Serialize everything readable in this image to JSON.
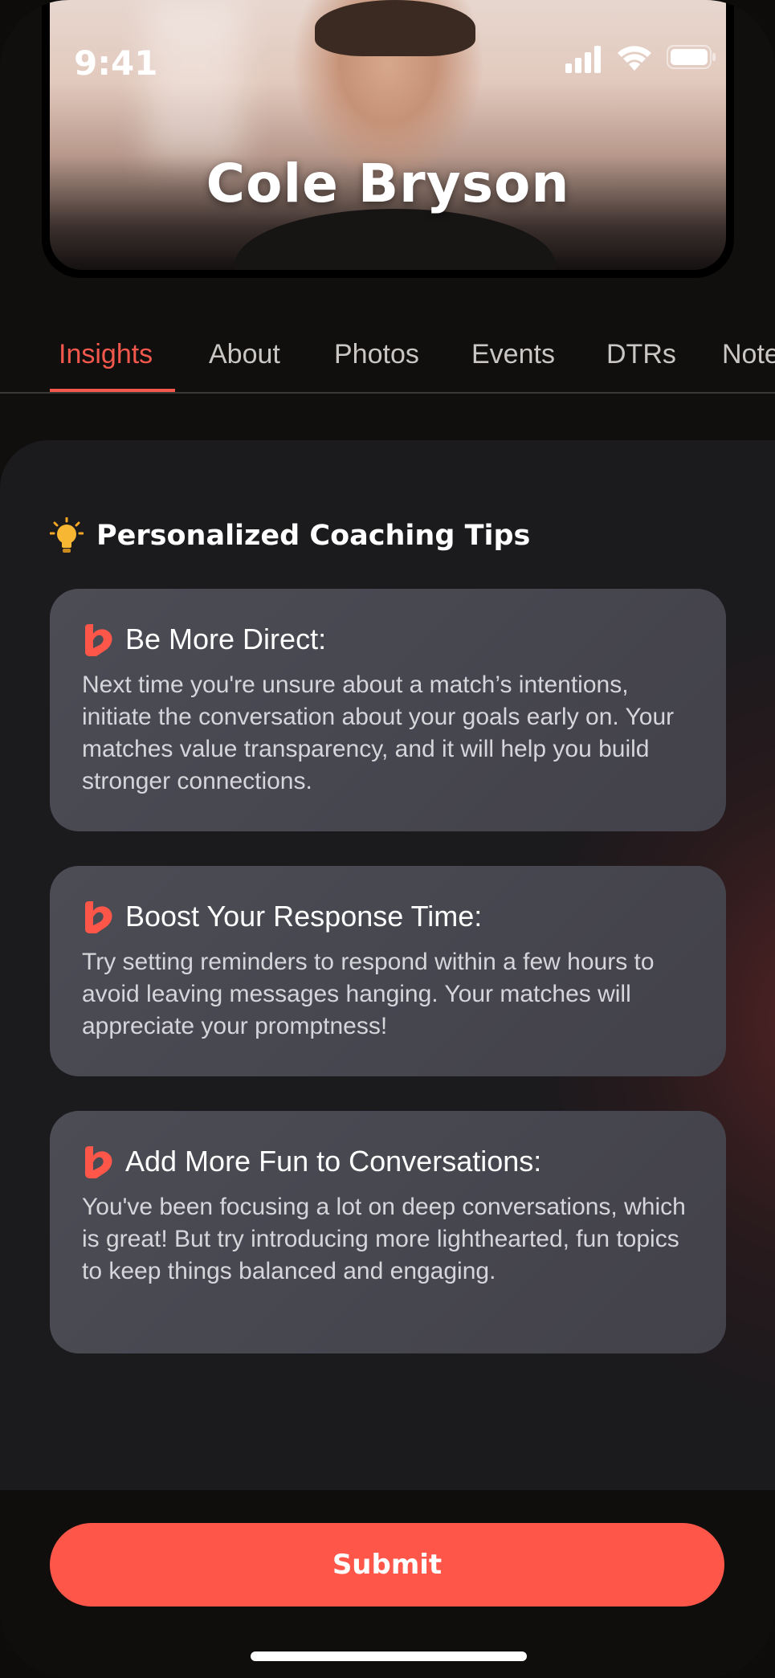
{
  "status_bar": {
    "time": "9:41"
  },
  "profile": {
    "name": "Cole Bryson"
  },
  "tabs": [
    {
      "label": "Insights",
      "active": true
    },
    {
      "label": "About",
      "active": false
    },
    {
      "label": "Photos",
      "active": false
    },
    {
      "label": "Events",
      "active": false
    },
    {
      "label": "DTRs",
      "active": false
    },
    {
      "label": "Notes",
      "active": false
    }
  ],
  "insights": {
    "section_title": "Personalized Coaching Tips",
    "section_icon": "lightbulb-icon",
    "tips": [
      {
        "icon": "brand-heart-logo-icon",
        "title": "Be More Direct:",
        "body": "Next time you're unsure about a match’s intentions, initiate the conversation about your goals early on. Your matches value transparency, and it will help you build stronger connections."
      },
      {
        "icon": "brand-heart-logo-icon",
        "title": "Boost Your Response Time:",
        "body": "Try setting reminders to respond within a few hours to avoid leaving messages hanging. Your matches will appreciate your promptness!"
      },
      {
        "icon": "brand-heart-logo-icon",
        "title": "Add More Fun to Conversations:",
        "body": "You've been focusing a lot on deep conversations, which is great! But try introducing more lighthearted, fun topics to keep things balanced and engaging."
      }
    ]
  },
  "actions": {
    "submit_label": "Submit"
  },
  "colors": {
    "accent": "#ff564a",
    "tab_active": "#f4584c",
    "background": "#100f0e",
    "card": "#4a4a53"
  }
}
